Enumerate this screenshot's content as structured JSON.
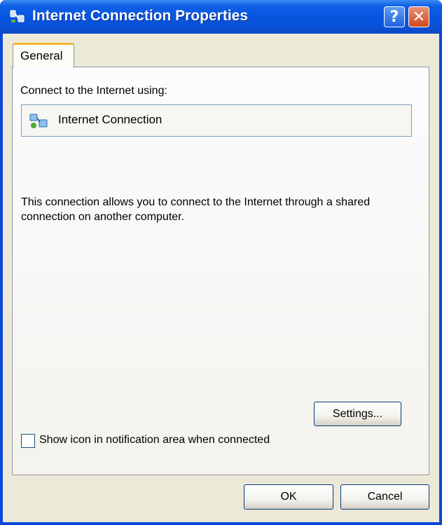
{
  "window": {
    "title": "Internet Connection Properties",
    "help_label": "?",
    "close_label": "✕"
  },
  "tabs": [
    {
      "label": "General",
      "selected": true
    }
  ],
  "general": {
    "connect_label": "Connect to the Internet using:",
    "connection_name": "Internet Connection",
    "description": "This connection allows you to connect to the Internet through a shared connection on another computer.",
    "settings_button": "Settings...",
    "show_icon_label": "Show icon in notification area when connected",
    "show_icon_checked": false
  },
  "footer": {
    "ok_label": "OK",
    "cancel_label": "Cancel"
  },
  "colors": {
    "titlebar": "#0656e0",
    "dialog_face": "#ece9d8",
    "tab_highlight": "#f4b430",
    "close_button": "#d2461e"
  },
  "icons": {
    "title": "network-connection-icon",
    "connection": "network-connection-icon"
  }
}
